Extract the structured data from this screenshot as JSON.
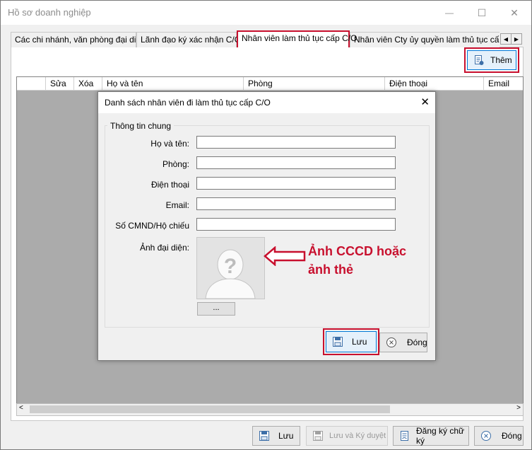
{
  "window": {
    "title": "Hồ sơ doanh nghiệp",
    "minimize_glyph": "—",
    "maximize_glyph": "☐",
    "close_glyph": "✕"
  },
  "tabs": [
    {
      "label": "Các chi nhánh, văn phòng đại diện"
    },
    {
      "label": "Lãnh đạo ký xác nhận C/O"
    },
    {
      "label": "Nhân viên làm thủ tục cấp C/O",
      "active": true
    },
    {
      "label": "Nhân viên Cty ủy quyền làm thủ tục cấp C/O"
    }
  ],
  "tab_nav": {
    "prev": "◀",
    "next": "▶"
  },
  "toolbar": {
    "add_label": "Thêm",
    "add_icon": "document-add-icon"
  },
  "grid": {
    "columns": [
      "Sửa",
      "Xóa",
      "Họ và tên",
      "Phòng",
      "Điện thoại",
      "Email"
    ]
  },
  "dialog": {
    "title": "Danh sách nhân viên đi làm thủ tục cấp C/O",
    "close_glyph": "✕",
    "group_title": "Thông tin chung",
    "fields": [
      {
        "label": "Họ và tên:",
        "value": ""
      },
      {
        "label": "Phòng:",
        "value": ""
      },
      {
        "label": "Điện thoại",
        "value": ""
      },
      {
        "label": "Email:",
        "value": ""
      },
      {
        "label": "Số CMND/Hộ chiếu",
        "value": ""
      }
    ],
    "photo_label": "Ảnh đại diện:",
    "browse_label": "...",
    "save_label": "Lưu",
    "close_label": "Đóng"
  },
  "annotation": {
    "line1": "Ảnh CCCD hoặc",
    "line2": "ảnh thẻ",
    "color": "#c8102e"
  },
  "footer": {
    "save_label": "Lưu",
    "save_approve_label": "Lưu và Ký duyệt",
    "register_signature_label": "Đăng ký chữ ký",
    "close_label": "Đóng"
  },
  "colors": {
    "highlight": "#c8102e",
    "grid_background": "#ababab"
  }
}
